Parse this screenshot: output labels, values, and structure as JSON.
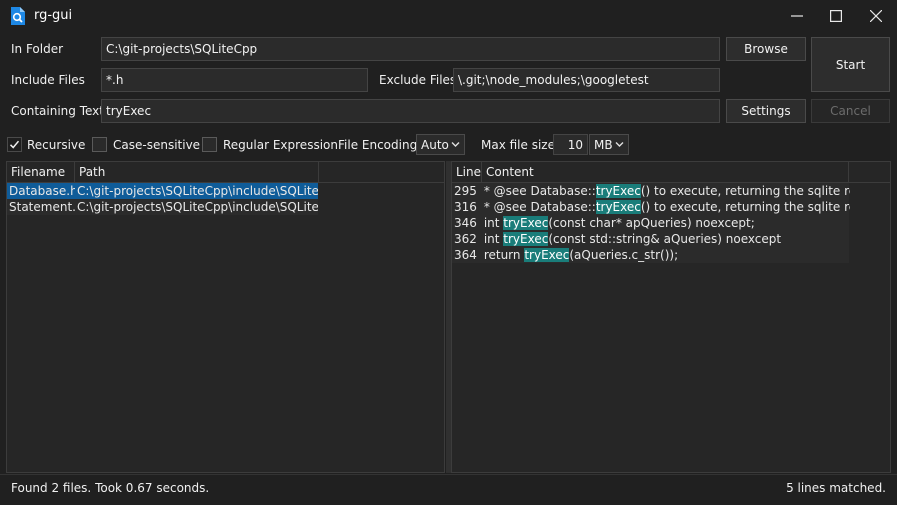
{
  "window": {
    "title": "rg-gui",
    "icon": "magnifier-document-icon",
    "controls": [
      "minimize-icon",
      "maximize-icon",
      "close-icon"
    ]
  },
  "form": {
    "in_folder_label": "In Folder",
    "in_folder_value": "C:\\git-projects\\SQLiteCpp",
    "include_files_label": "Include Files",
    "include_files_value": "*.h",
    "exclude_files_label": "Exclude Files",
    "exclude_files_value": "\\.git;\\node_modules;\\googletest",
    "containing_text_label": "Containing Text",
    "containing_text_value": "tryExec",
    "browse_label": "Browse",
    "start_label": "Start",
    "settings_label": "Settings",
    "cancel_label": "Cancel"
  },
  "options": {
    "recursive_label": "Recursive",
    "recursive_checked": true,
    "case_sensitive_label": "Case-sensitive",
    "case_sensitive_checked": false,
    "regex_label": "Regular Expression",
    "regex_checked": false,
    "encoding_label": "File Encoding:",
    "encoding_value": "Auto",
    "max_size_label": "Max file size:",
    "max_size_value": "10",
    "max_size_unit": "MB"
  },
  "files": {
    "columns": [
      "Filename",
      "Path"
    ],
    "rows": [
      {
        "name": "Database.h",
        "path": "C:\\git-projects\\SQLiteCpp\\include\\SQLiteCpp",
        "selected": true
      },
      {
        "name": "Statement.h",
        "path": "C:\\git-projects\\SQLiteCpp\\include\\SQLiteCpp",
        "selected": false
      }
    ]
  },
  "matches": {
    "columns": [
      "Line",
      "Content"
    ],
    "rows": [
      {
        "line": "295",
        "before": " * @see Database::",
        "match": "tryExec",
        "after": "() to execute, returning the sqlite result code"
      },
      {
        "line": "316",
        "before": " * @see Database::",
        "match": "tryExec",
        "after": "() to execute, returning the sqlite result code"
      },
      {
        "line": "346",
        "before": " int ",
        "match": "tryExec",
        "after": "(const char* apQueries) noexcept;"
      },
      {
        "line": "362",
        "before": " int ",
        "match": "tryExec",
        "after": "(const std::string& aQueries) noexcept"
      },
      {
        "line": "364",
        "before": " return ",
        "match": "tryExec",
        "after": "(aQueries.c_str());"
      }
    ]
  },
  "status": {
    "left": "Found 2 files.  Took 0.67 seconds.",
    "right": "5 lines matched."
  },
  "colors": {
    "background": "#202020",
    "selection": "#0f5c99",
    "match_highlight": "#1a7d7a"
  }
}
